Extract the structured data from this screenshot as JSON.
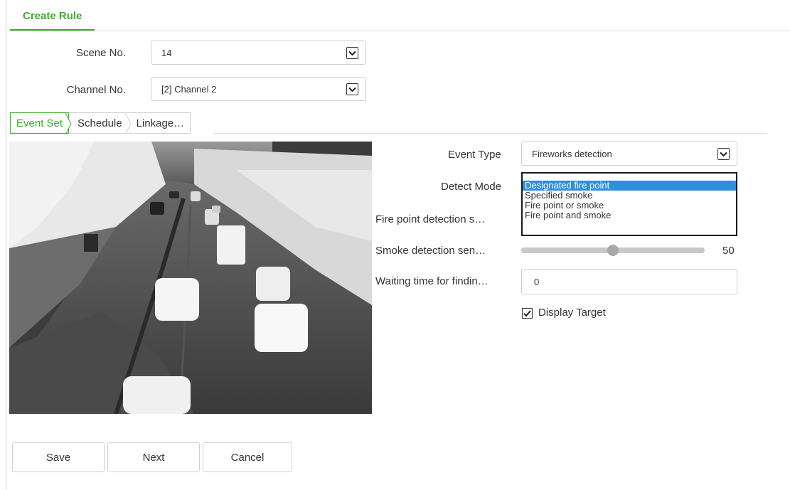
{
  "header": {
    "tab_label": "Create Rule"
  },
  "form": {
    "scene_label": "Scene No.",
    "scene_value": "14",
    "channel_label": "Channel No.",
    "channel_value": "[2] Channel 2"
  },
  "subtabs": [
    {
      "label": "Event Set",
      "active": true
    },
    {
      "label": "Schedule",
      "active": false
    },
    {
      "label": "Linkage…",
      "active": false
    }
  ],
  "event": {
    "event_type_label": "Event Type",
    "event_type_value": "Fireworks detection",
    "detect_mode_label": "Detect Mode",
    "detect_mode_options": [
      "Designated fire point",
      "Specified smoke",
      "Fire point or smoke",
      "Fire point and smoke"
    ],
    "detect_mode_selected_index": 0,
    "fire_sens_label": "Fire point detection s…",
    "smoke_sens_label": "Smoke detection sen…",
    "smoke_sens_value": "50",
    "smoke_sens_fraction": 0.5,
    "waiting_label": "Waiting time for findin…",
    "waiting_value": "0",
    "display_target_label": "Display Target",
    "display_target_checked": true
  },
  "buttons": {
    "save": "Save",
    "next": "Next",
    "cancel": "Cancel"
  },
  "colors": {
    "accent": "#3cae2b",
    "selection": "#2f8fdc"
  }
}
